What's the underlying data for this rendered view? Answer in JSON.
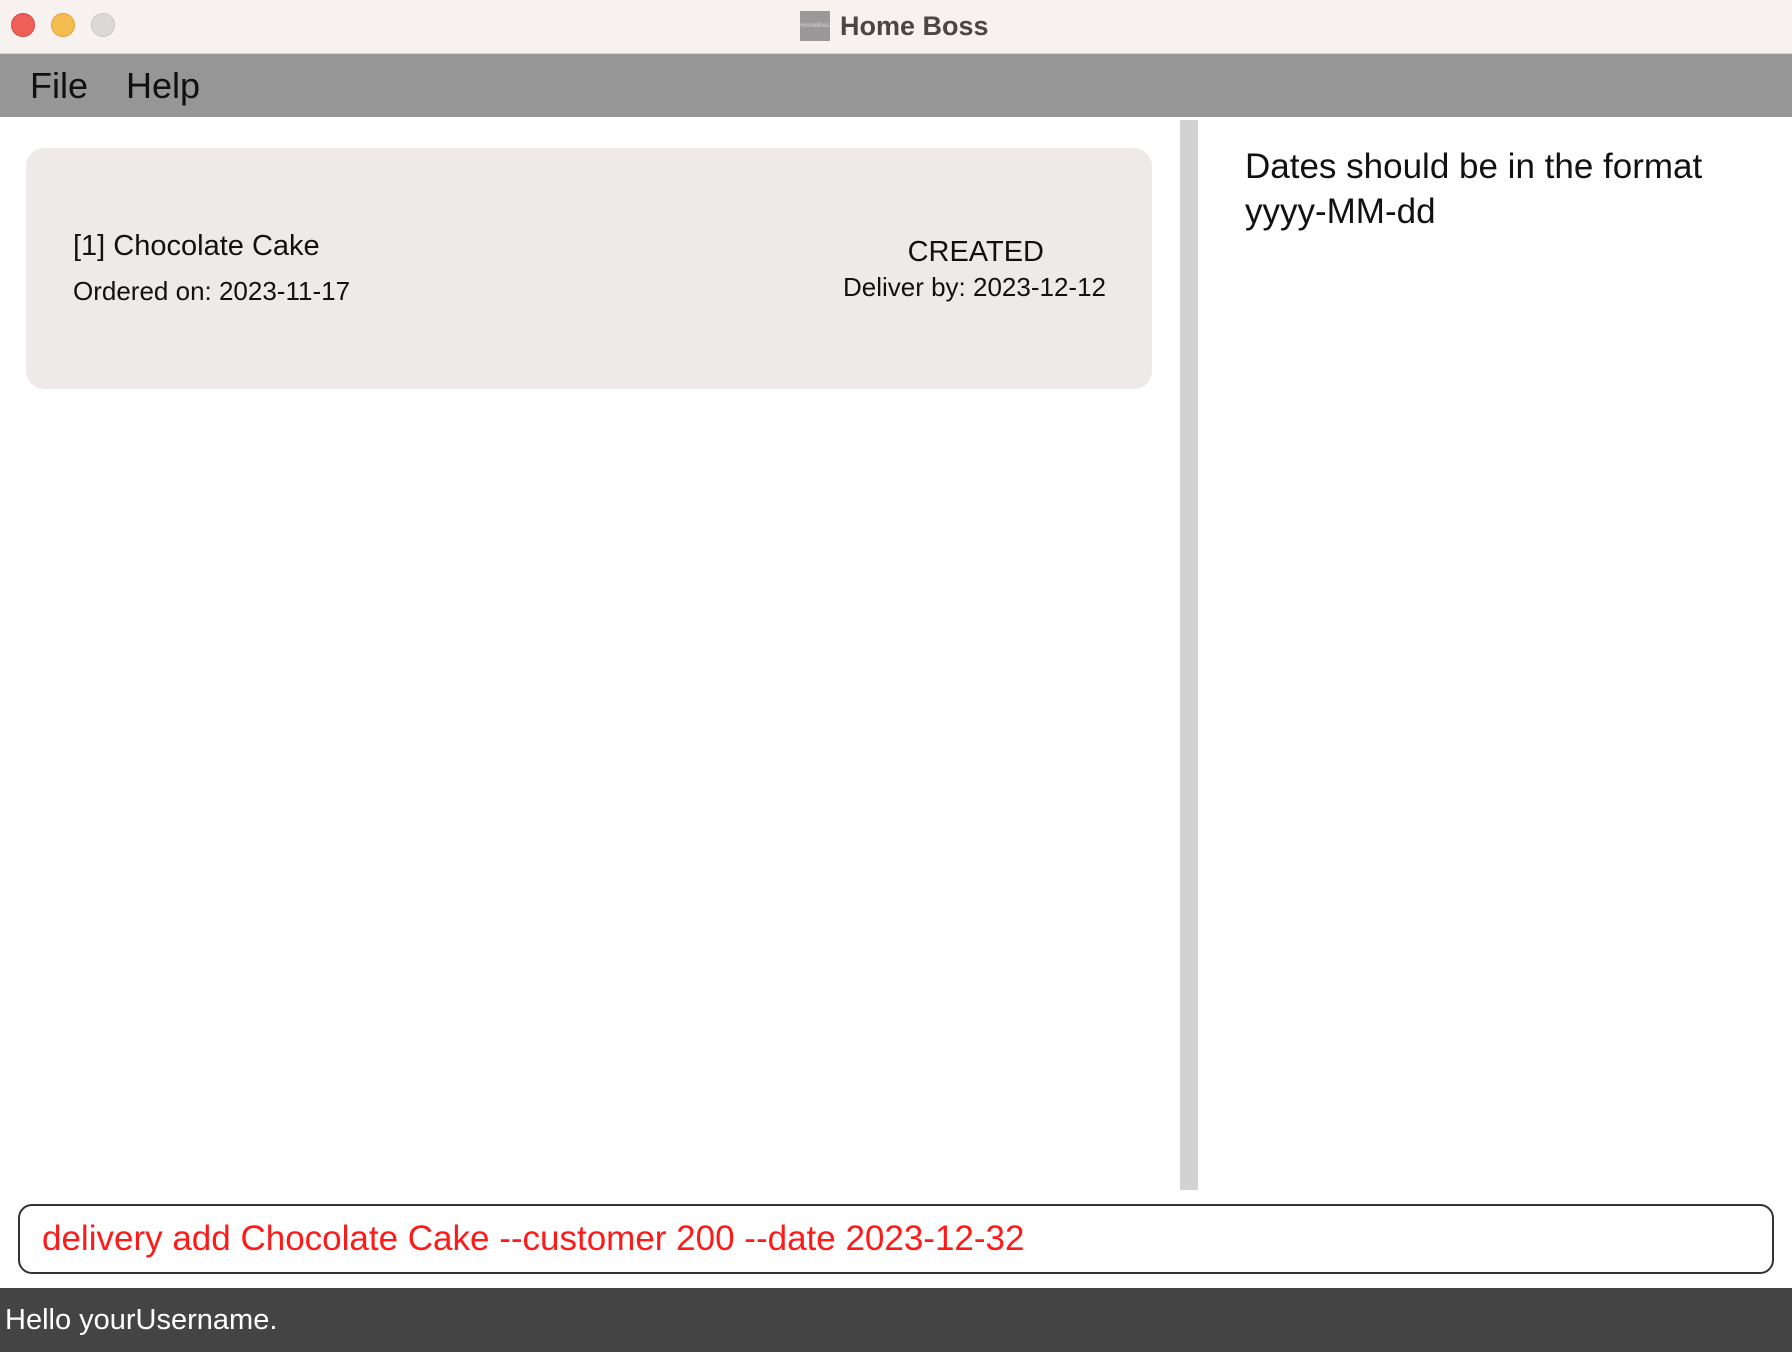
{
  "window": {
    "title": "Home Boss",
    "icon_text": "HomeBoss"
  },
  "menu": {
    "items": [
      {
        "label": "File"
      },
      {
        "label": "Help"
      }
    ]
  },
  "orders": [
    {
      "name": "[1] Chocolate Cake",
      "ordered_on": "Ordered on: 2023-11-17",
      "status": "CREATED",
      "deliver_by": "Deliver by: 2023-12-12"
    }
  ],
  "result": {
    "message": "Dates should be in the format\nyyyy-MM-dd"
  },
  "command": {
    "value": "delivery add Chocolate Cake --customer 200 --date 2023-12-32",
    "color": "#ff1a1a"
  },
  "status": {
    "text": "Hello yourUsername."
  }
}
